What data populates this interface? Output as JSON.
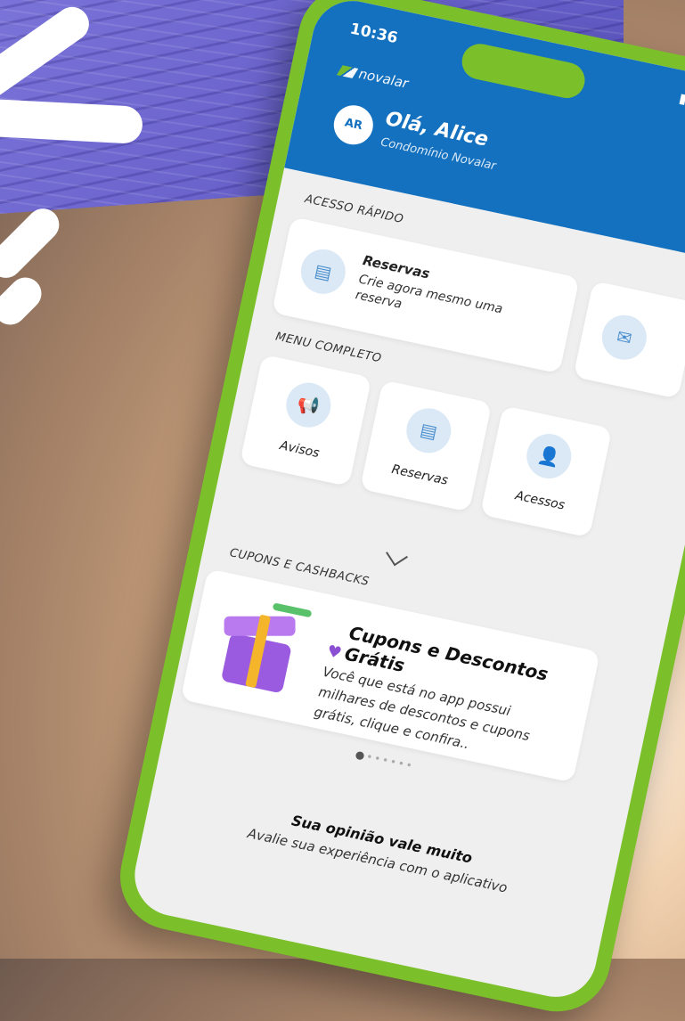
{
  "status_bar": {
    "time": "10:36",
    "icons": "▮▮▮ ◔ ▬"
  },
  "app": {
    "brand": "novalar"
  },
  "user": {
    "avatar_initials": "AR",
    "greeting": "Olá, Alice",
    "condominium": "Condomínio Novalar"
  },
  "quick_access": {
    "title": "ACESSO RÁPIDO",
    "items": [
      {
        "title": "Reservas",
        "description": "Crie agora mesmo uma reserva",
        "icon": "calendar-icon"
      },
      {
        "title": "",
        "description": "",
        "icon": "mail-icon"
      }
    ]
  },
  "full_menu": {
    "title": "MENU COMPLETO",
    "items": [
      {
        "label": "Avisos",
        "icon": "megaphone-icon"
      },
      {
        "label": "Reservas",
        "icon": "calendar-icon"
      },
      {
        "label": "Acessos",
        "icon": "user-add-icon"
      }
    ]
  },
  "coupons": {
    "title": "CUPONS E CASHBACKS",
    "card_title": "Cupons e Descontos Grátis",
    "card_description": "Você que está no app possui milhares de descontos e cupons grátis, clique e confira..",
    "carousel_position": 1,
    "carousel_total": 7
  },
  "feedback": {
    "title": "Sua opinião vale muito",
    "subtitle": "Avalie sua experiência com o aplicativo"
  },
  "colors": {
    "header_blue": "#1471bf",
    "phone_green": "#7bc02a",
    "accent_purple": "#8b4fd3",
    "background_purple": "#6a63cc"
  }
}
